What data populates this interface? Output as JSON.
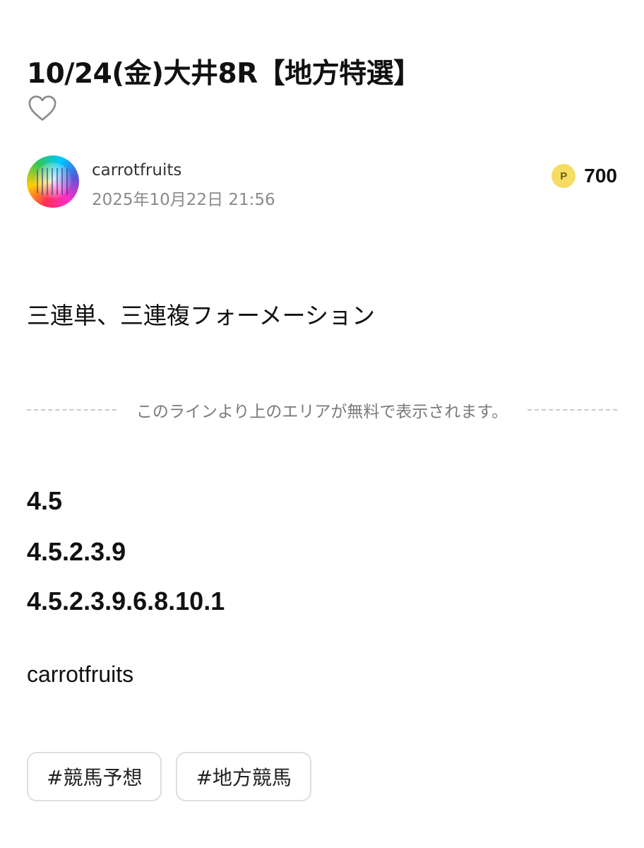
{
  "article": {
    "title": "10/24(金)大井8R【地方特選】"
  },
  "author": {
    "name": "carrotfruits",
    "date": "2025年10月22日 21:56"
  },
  "price": {
    "currency_mark": "P",
    "value": "700"
  },
  "body": {
    "intro": "三連単、三連複フォーメーション",
    "paywall_notice": "このラインより上のエリアが無料で表示されます。",
    "picks": [
      "4.5",
      "4.5.2.3.9",
      "4.5.2.3.9.6.8.10.1"
    ],
    "signature": "carrotfruits"
  },
  "tags": [
    "#競馬予想",
    "#地方競馬"
  ],
  "icons": {
    "like": "heart-outline-icon",
    "point": "point-coin-icon"
  },
  "colors": {
    "point_coin": "#f5dd63",
    "muted_text": "#8a8a8a",
    "divider": "#c9c9c9"
  }
}
